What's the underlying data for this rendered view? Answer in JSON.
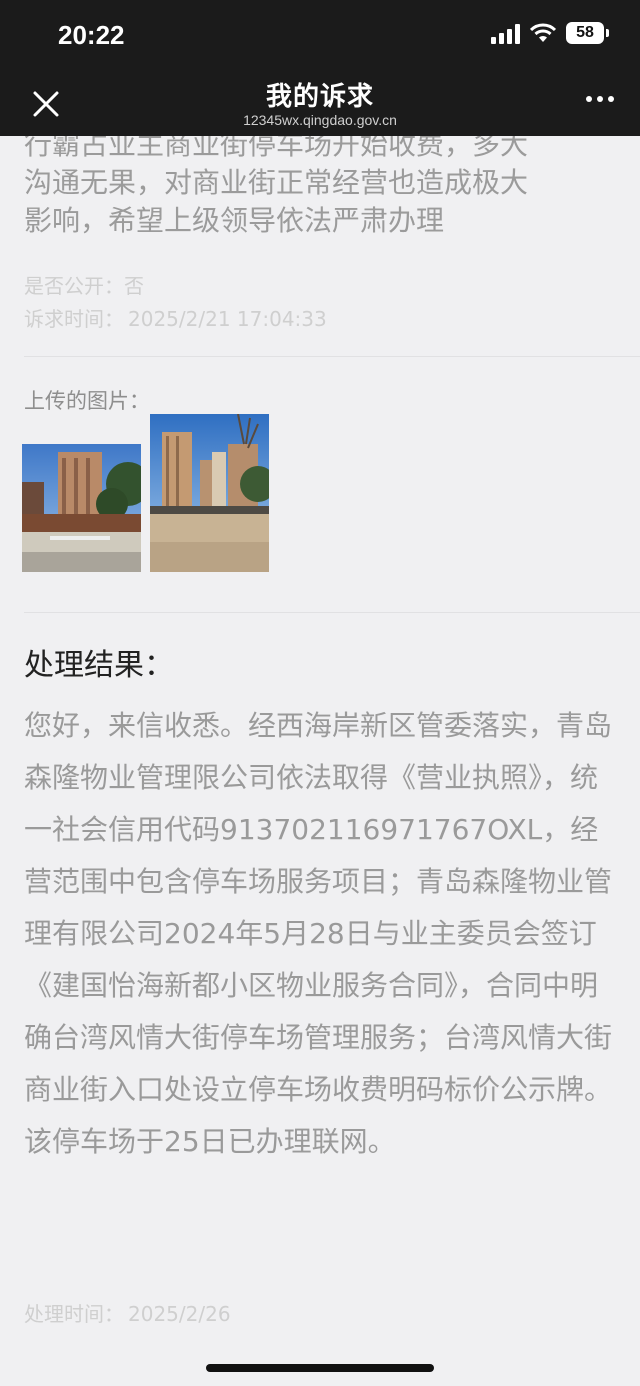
{
  "status_bar": {
    "time": "20:22",
    "battery": "58"
  },
  "nav": {
    "title": "我的诉求",
    "url": "12345wx.qingdao.gov.cn"
  },
  "complaint": {
    "text_lines": [
      "行霸占业主商业街停车场开始收费，多大",
      "沟通无果，对商业街正常经营也造成极大",
      "影响，希望上级领导依法严肃办理"
    ],
    "public_label": "是否公开：",
    "public_value": "否",
    "time_label": "诉求时间：",
    "time_value": "2025/2/21 17:04:33",
    "images_label": "上传的图片："
  },
  "result": {
    "title": "处理结果：",
    "body": "您好，来信收悉。经西海岸新区管委落实，青岛森隆物业管理限公司依法取得《营业执照》，统一社会信用代码913702116971767OXL，经营范围中包含停车场服务项目；青岛森隆物业管理有限公司2024年5月28日与业主委员会签订《建国怡海新都小区物业服务合同》，合同中明确台湾风情大街停车场管理服务；台湾风情大街商业街入口处设立停车场收费明码标价公示牌。该停车场于25日已办理联网。",
    "time_label": "处理时间：",
    "time_value": "2025/2/26"
  }
}
